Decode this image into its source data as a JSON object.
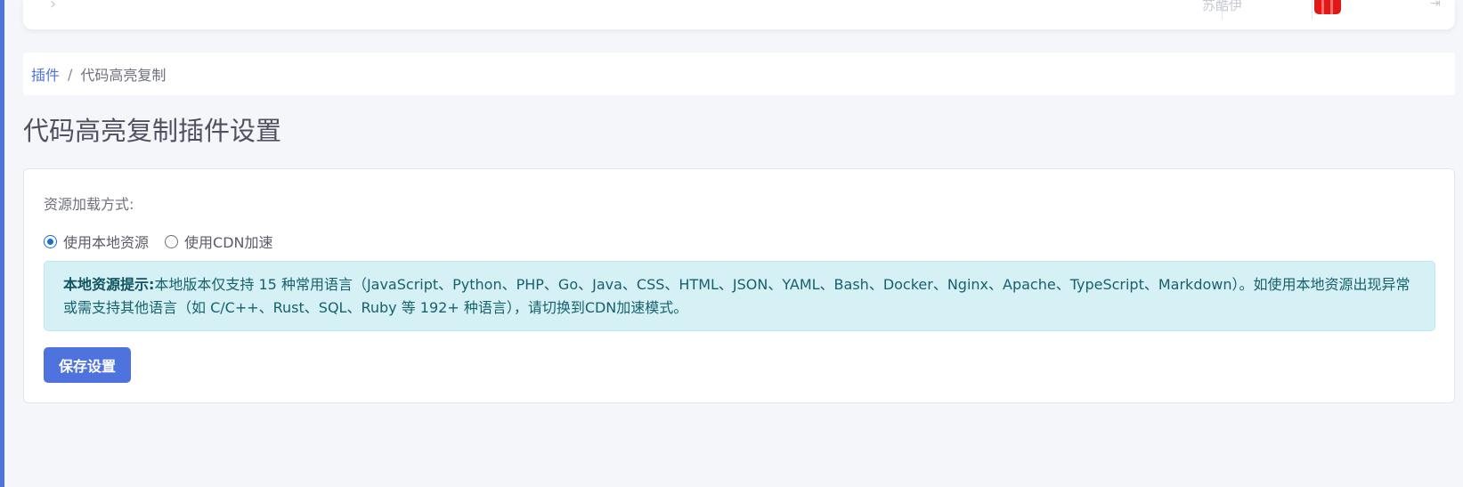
{
  "topbar": {
    "toggle_icon": "chevron-right-icon",
    "username": "苏酷伊",
    "avatar_icon": "avatar-icon",
    "logout_icon": "logout-icon"
  },
  "breadcrumb": {
    "parent": "插件",
    "separator": "/",
    "current": "代码高亮复制"
  },
  "page": {
    "title": "代码高亮复制插件设置"
  },
  "form": {
    "resource_label": "资源加载方式:",
    "options": [
      {
        "label": "使用本地资源",
        "checked": true
      },
      {
        "label": "使用CDN加速",
        "checked": false
      }
    ],
    "alert": {
      "title": "本地资源提示:",
      "text": "本地版本仅支持 15 种常用语言（JavaScript、Python、PHP、Go、Java、CSS、HTML、JSON、YAML、Bash、Docker、Nginx、Apache、TypeScript、Markdown）。如使用本地资源出现异常或需支持其他语言（如 C/C++、Rust、SQL、Ruby 等 192+ 种语言），请切换到CDN加速模式。"
    },
    "save_label": "保存设置"
  },
  "colors": {
    "accent": "#4e73df",
    "info_bg": "#d6f1f5",
    "info_text": "#16616d"
  }
}
